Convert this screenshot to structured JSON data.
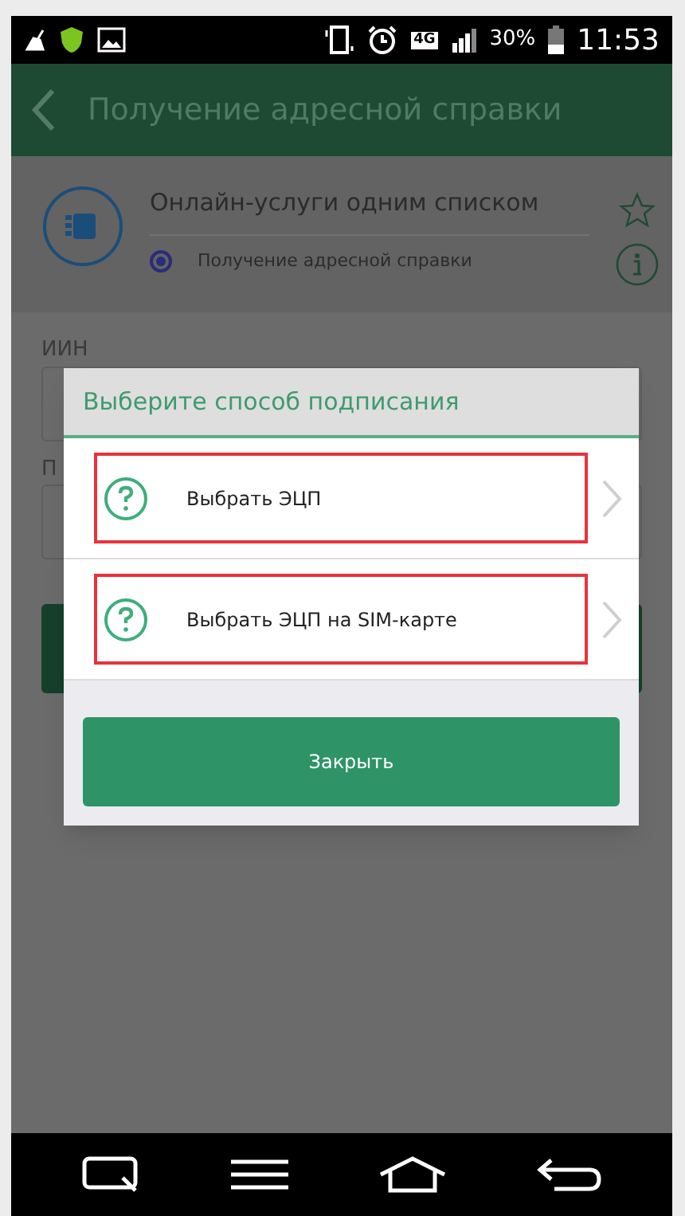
{
  "status_bar": {
    "network": "4G",
    "battery": "30%",
    "time": "11:53"
  },
  "app_bar": {
    "title": "Получение адресной справки"
  },
  "service": {
    "title": "Онлайн-услуги одним списком",
    "subtitle": "Получение адресной справки",
    "selected": true
  },
  "form": {
    "fields": [
      {
        "label": "ИИН"
      },
      {
        "label": "П"
      }
    ]
  },
  "dialog": {
    "title": "Выберите способ подписания",
    "options": [
      {
        "label": "Выбрать ЭЦП",
        "highlighted": true
      },
      {
        "label": "Выбрать ЭЦП на SIM-карте",
        "highlighted": true
      }
    ],
    "close_button": "Закрыть"
  }
}
